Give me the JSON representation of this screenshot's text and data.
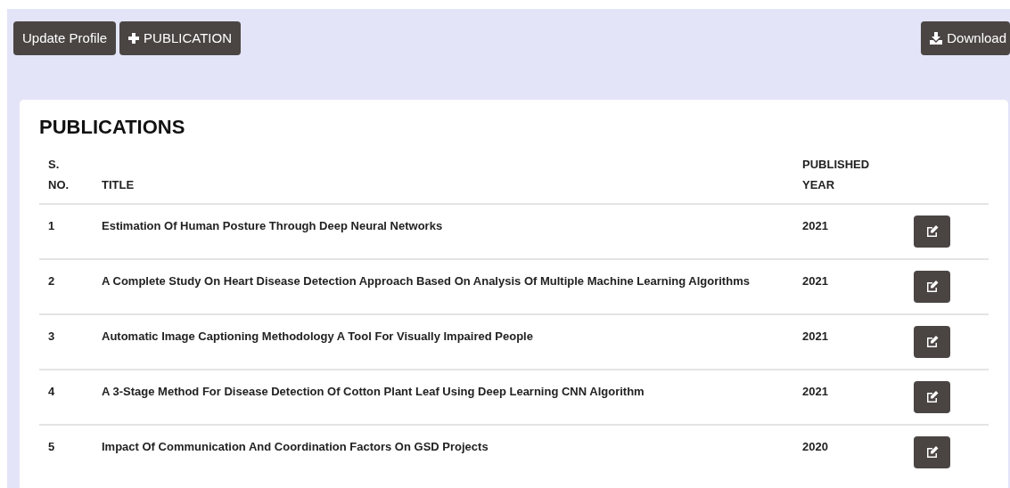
{
  "toolbar": {
    "buttons": [
      {
        "kind": "text",
        "label": "Update Profile"
      },
      {
        "kind": "add",
        "label": "PUBLICATION"
      }
    ],
    "download_button": {
      "label": "Download"
    }
  },
  "card": {
    "title": "PUBLICATIONS",
    "columns": [
      "S.\nNO.",
      "TITLE",
      "PUBLISHED\nYEAR"
    ],
    "rows": [
      {
        "no": "1",
        "title": "Estimation Of Human Posture Through Deep Neural Networks",
        "year": "2021"
      },
      {
        "no": "2",
        "title": "A Complete Study On Heart Disease Detection Approach Based On Analysis Of Multiple Machine Learning Algorithms",
        "year": "2021"
      },
      {
        "no": "3",
        "title": "Automatic Image Captioning Methodology A Tool For Visually Impaired People",
        "year": "2021"
      },
      {
        "no": "4",
        "title": "A 3-Stage Method For Disease Detection Of Cotton Plant Leaf Using Deep Learning CNN Algorithm",
        "year": "2021"
      },
      {
        "no": "5",
        "title": "Impact Of Communication And Coordination Factors On GSD Projects",
        "year": "2020"
      }
    ]
  }
}
